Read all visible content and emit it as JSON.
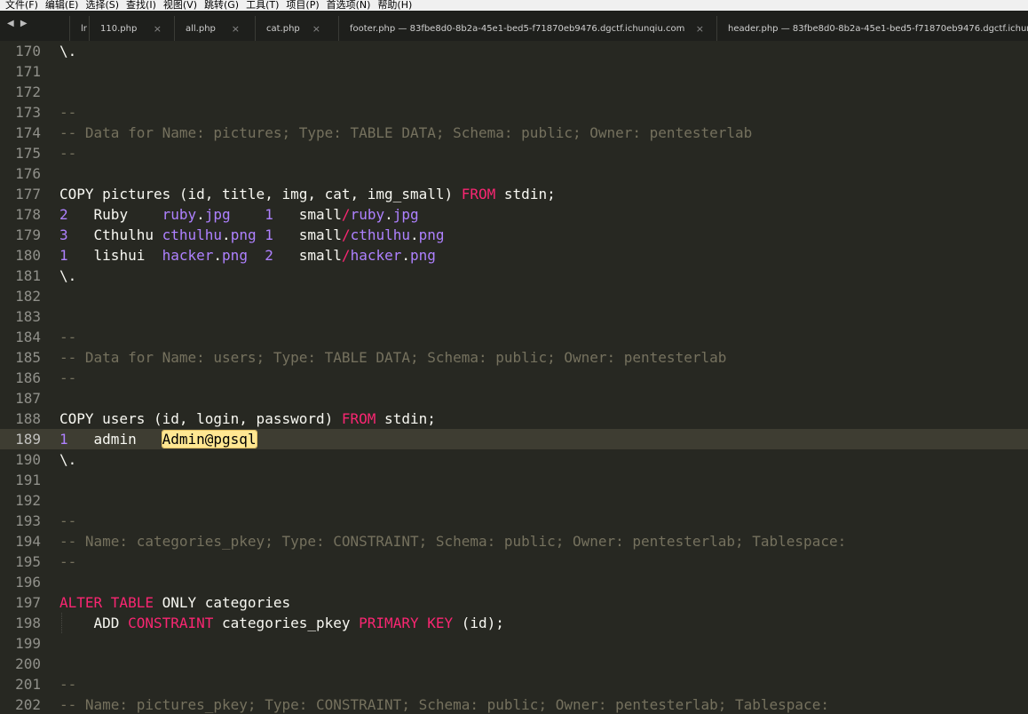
{
  "menu": [
    "文件(F)",
    "编辑(E)",
    "选择(S)",
    "查找(I)",
    "视图(V)",
    "跳转(G)",
    "工具(T)",
    "项目(P)",
    "首选项(N)",
    "帮助(H)"
  ],
  "nav_arrows": "◀ ▶",
  "tabs": [
    {
      "label": "lr",
      "close": ""
    },
    {
      "label": "110.php",
      "close": "×"
    },
    {
      "label": "all.php",
      "close": "×"
    },
    {
      "label": "cat.php",
      "close": "×"
    },
    {
      "label": "footer.php — 83fbe8d0-8b2a-45e1-bed5-f71870eb9476.dgctf.ichunqiu.com",
      "close": "×"
    },
    {
      "label": "header.php — 83fbe8d0-8b2a-45e1-bed5-f71870eb9476.dgctf.ichunq",
      "close": ""
    }
  ],
  "lines": [
    {
      "n": "170",
      "t": [
        {
          "c": "",
          "s": "\\."
        }
      ]
    },
    {
      "n": "171",
      "t": []
    },
    {
      "n": "172",
      "t": []
    },
    {
      "n": "173",
      "t": [
        {
          "c": "cm",
          "s": "--"
        }
      ]
    },
    {
      "n": "174",
      "t": [
        {
          "c": "cm",
          "s": "-- Data for Name: pictures; Type: TABLE DATA; Schema: public; Owner: pentesterlab"
        }
      ]
    },
    {
      "n": "175",
      "t": [
        {
          "c": "cm",
          "s": "--"
        }
      ]
    },
    {
      "n": "176",
      "t": []
    },
    {
      "n": "177",
      "t": [
        {
          "c": "",
          "s": "COPY pictures (id, title, img, cat, img_small) "
        },
        {
          "c": "kw",
          "s": "FROM"
        },
        {
          "c": "",
          "s": " stdin;"
        }
      ]
    },
    {
      "n": "178",
      "t": [
        {
          "c": "pu",
          "s": "2"
        },
        {
          "c": "",
          "s": "   Ruby    "
        },
        {
          "c": "pu",
          "s": "ruby"
        },
        {
          "c": "",
          "s": "."
        },
        {
          "c": "pu",
          "s": "jpg"
        },
        {
          "c": "",
          "s": "    "
        },
        {
          "c": "pu",
          "s": "1"
        },
        {
          "c": "",
          "s": "   small"
        },
        {
          "c": "kw",
          "s": "/"
        },
        {
          "c": "pu",
          "s": "ruby"
        },
        {
          "c": "",
          "s": "."
        },
        {
          "c": "pu",
          "s": "jpg"
        }
      ]
    },
    {
      "n": "179",
      "t": [
        {
          "c": "pu",
          "s": "3"
        },
        {
          "c": "",
          "s": "   Cthulhu "
        },
        {
          "c": "pu",
          "s": "cthulhu"
        },
        {
          "c": "",
          "s": "."
        },
        {
          "c": "pu",
          "s": "png"
        },
        {
          "c": "",
          "s": " "
        },
        {
          "c": "pu",
          "s": "1"
        },
        {
          "c": "",
          "s": "   small"
        },
        {
          "c": "kw",
          "s": "/"
        },
        {
          "c": "pu",
          "s": "cthulhu"
        },
        {
          "c": "",
          "s": "."
        },
        {
          "c": "pu",
          "s": "png"
        }
      ]
    },
    {
      "n": "180",
      "t": [
        {
          "c": "pu",
          "s": "1"
        },
        {
          "c": "",
          "s": "   lishui  "
        },
        {
          "c": "pu",
          "s": "hacker"
        },
        {
          "c": "",
          "s": "."
        },
        {
          "c": "pu",
          "s": "png"
        },
        {
          "c": "",
          "s": "  "
        },
        {
          "c": "pu",
          "s": "2"
        },
        {
          "c": "",
          "s": "   small"
        },
        {
          "c": "kw",
          "s": "/"
        },
        {
          "c": "pu",
          "s": "hacker"
        },
        {
          "c": "",
          "s": "."
        },
        {
          "c": "pu",
          "s": "png"
        }
      ]
    },
    {
      "n": "181",
      "t": [
        {
          "c": "",
          "s": "\\."
        }
      ]
    },
    {
      "n": "182",
      "t": []
    },
    {
      "n": "183",
      "t": []
    },
    {
      "n": "184",
      "t": [
        {
          "c": "cm",
          "s": "--"
        }
      ]
    },
    {
      "n": "185",
      "t": [
        {
          "c": "cm",
          "s": "-- Data for Name: users; Type: TABLE DATA; Schema: public; Owner: pentesterlab"
        }
      ]
    },
    {
      "n": "186",
      "t": [
        {
          "c": "cm",
          "s": "--"
        }
      ]
    },
    {
      "n": "187",
      "t": []
    },
    {
      "n": "188",
      "t": [
        {
          "c": "",
          "s": "COPY users (id, login, password) "
        },
        {
          "c": "kw",
          "s": "FROM"
        },
        {
          "c": "",
          "s": " stdin;"
        }
      ]
    },
    {
      "n": "189",
      "current": true,
      "t": [
        {
          "c": "pu",
          "s": "1"
        },
        {
          "c": "",
          "s": "   admin   "
        },
        {
          "c": "hl",
          "s": "Admin@pgsql"
        }
      ]
    },
    {
      "n": "190",
      "t": [
        {
          "c": "",
          "s": "\\."
        }
      ]
    },
    {
      "n": "191",
      "t": []
    },
    {
      "n": "192",
      "t": []
    },
    {
      "n": "193",
      "t": [
        {
          "c": "cm",
          "s": "--"
        }
      ]
    },
    {
      "n": "194",
      "t": [
        {
          "c": "cm",
          "s": "-- Name: categories_pkey; Type: CONSTRAINT; Schema: public; Owner: pentesterlab; Tablespace:"
        }
      ]
    },
    {
      "n": "195",
      "t": [
        {
          "c": "cm",
          "s": "--"
        }
      ]
    },
    {
      "n": "196",
      "t": []
    },
    {
      "n": "197",
      "t": [
        {
          "c": "kw",
          "s": "ALTER TABLE"
        },
        {
          "c": "",
          "s": " ONLY categories"
        }
      ]
    },
    {
      "n": "198",
      "indent": true,
      "t": [
        {
          "c": "",
          "s": "    ADD "
        },
        {
          "c": "kw",
          "s": "CONSTRAINT"
        },
        {
          "c": "",
          "s": " categories_pkey "
        },
        {
          "c": "kw",
          "s": "PRIMARY KEY"
        },
        {
          "c": "",
          "s": " (id);"
        }
      ]
    },
    {
      "n": "199",
      "t": []
    },
    {
      "n": "200",
      "t": []
    },
    {
      "n": "201",
      "t": [
        {
          "c": "cm",
          "s": "--"
        }
      ]
    },
    {
      "n": "202",
      "t": [
        {
          "c": "cm",
          "s": "-- Name: pictures_pkey; Type: CONSTRAINT; Schema: public; Owner: pentesterlab; Tablespace:"
        }
      ]
    }
  ]
}
